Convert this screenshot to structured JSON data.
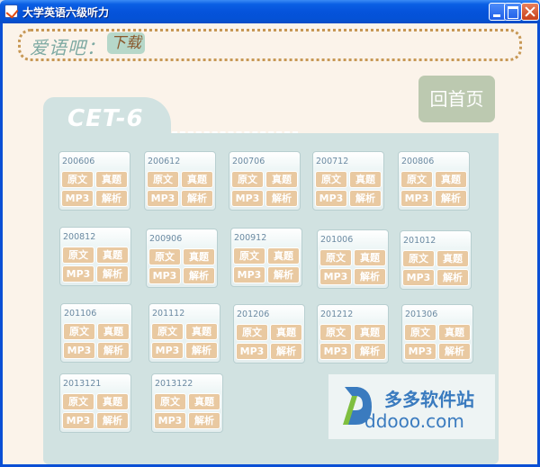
{
  "window": {
    "title": "大学英语六级听力"
  },
  "brand": {
    "name": "爱语吧：",
    "download": "下载"
  },
  "home_button": "回首页",
  "panel": {
    "tab_label": "CET-6"
  },
  "button_labels": {
    "original": "原文",
    "exam": "真题",
    "mp3": "MP3",
    "analysis": "解析"
  },
  "cards": [
    {
      "year": "200606"
    },
    {
      "year": "200612"
    },
    {
      "year": "200706"
    },
    {
      "year": "200712"
    },
    {
      "year": "200806"
    },
    {
      "year": "200812"
    },
    {
      "year": "200906"
    },
    {
      "year": "200912"
    },
    {
      "year": "201006"
    },
    {
      "year": "201012"
    },
    {
      "year": "201106"
    },
    {
      "year": "201112"
    },
    {
      "year": "201206"
    },
    {
      "year": "201212"
    },
    {
      "year": "201306"
    },
    {
      "year": "2013121"
    },
    {
      "year": "2013122"
    }
  ],
  "watermark": {
    "cn": "多多软件站",
    "en": "ddooo.com"
  },
  "colors": {
    "titlebar": "#0553db",
    "background": "#fbf3ea",
    "panel": "#d1e2e1",
    "button": "#e9c9a1",
    "home_button": "#bcc9b0",
    "brand_border": "#c79855"
  }
}
